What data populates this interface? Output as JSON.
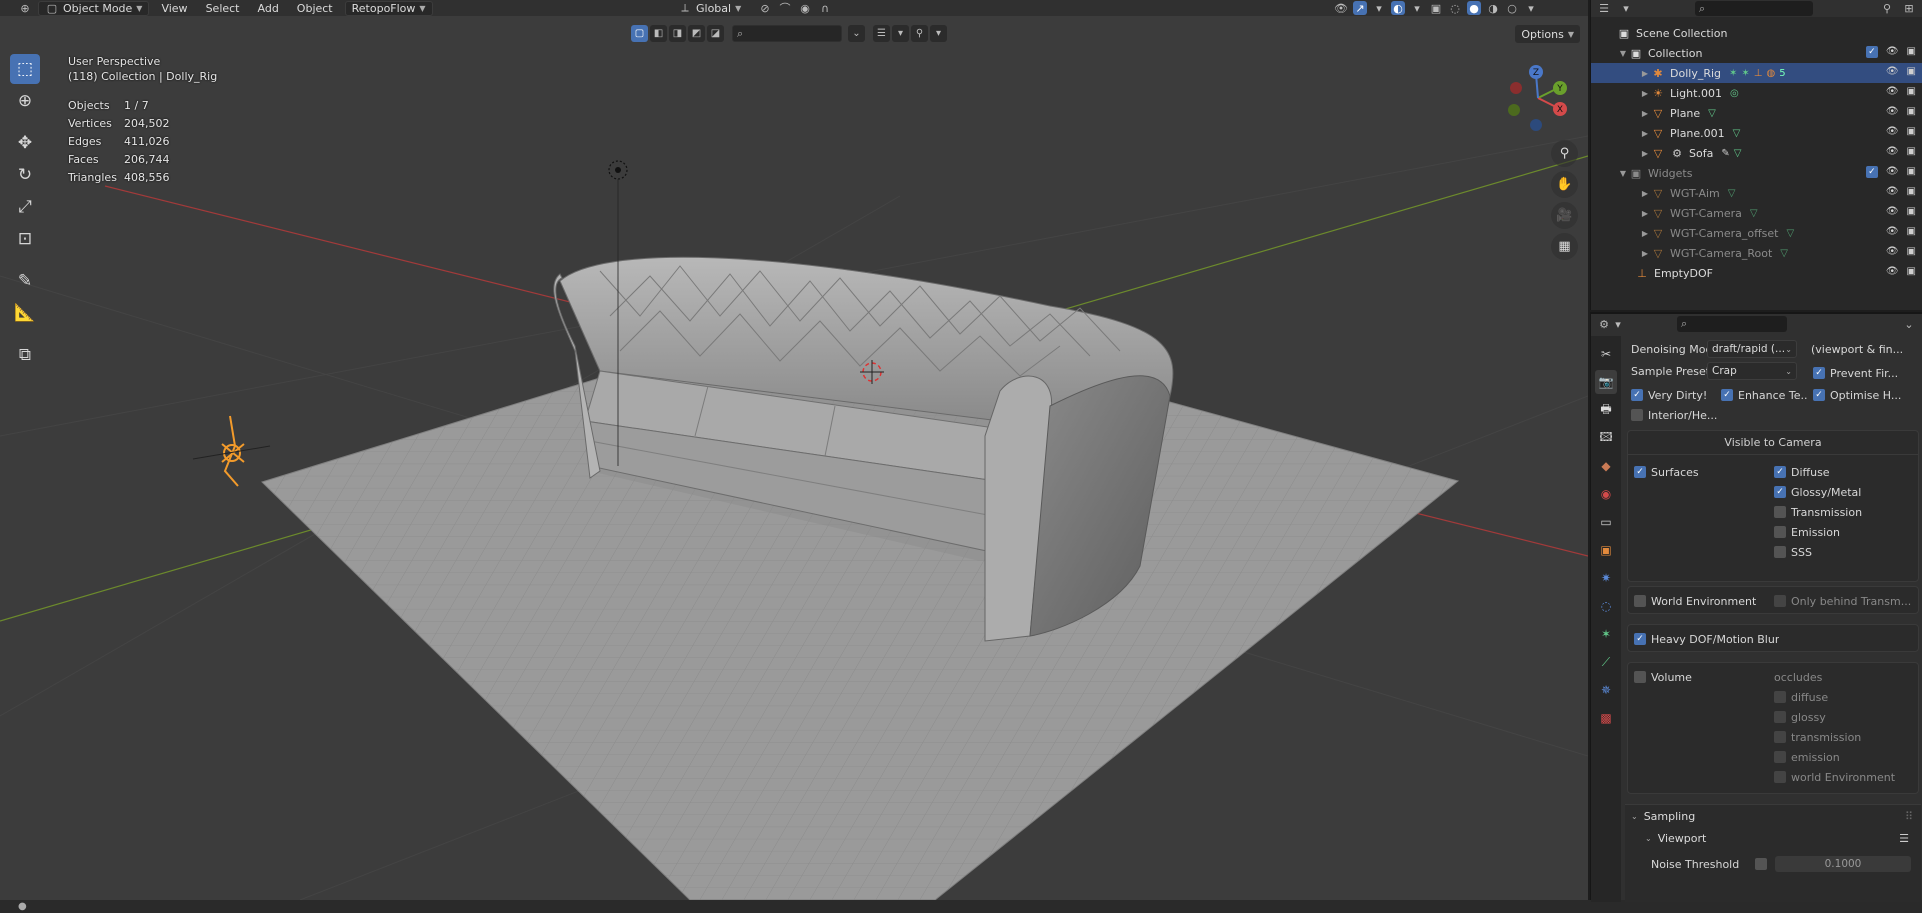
{
  "header": {
    "mode": "Object Mode",
    "menus": [
      "View",
      "Select",
      "Add",
      "Object",
      "RetopoFlow"
    ],
    "transform_orientation": "Global",
    "options_label": "Options"
  },
  "overlay": {
    "perspective": "User Perspective",
    "collection_line": "(118) Collection | Dolly_Rig",
    "stats": [
      {
        "label": "Objects",
        "value": "1 / 7"
      },
      {
        "label": "Vertices",
        "value": "204,502"
      },
      {
        "label": "Edges",
        "value": "411,026"
      },
      {
        "label": "Faces",
        "value": "206,744"
      },
      {
        "label": "Triangles",
        "value": "408,556"
      }
    ]
  },
  "gizmo": {
    "x": "X",
    "y": "Y",
    "z": "Z"
  },
  "outliner": {
    "scene_collection": "Scene Collection",
    "collection": "Collection",
    "items": [
      {
        "name": "Dolly_Rig",
        "selected": true,
        "badge": "5"
      },
      {
        "name": "Light.001"
      },
      {
        "name": "Plane"
      },
      {
        "name": "Plane.001"
      },
      {
        "name": "Sofa"
      }
    ],
    "widgets": "Widgets",
    "widget_items": [
      "WGT-Aim",
      "WGT-Camera",
      "WGT-Camera_offset",
      "WGT-Camera_Root"
    ],
    "empty": "EmptyDOF"
  },
  "properties": {
    "denoising_mode_label": "Denoising Mode",
    "denoising_mode_value": "draft/rapid (...",
    "denoising_side": "(viewport & fin...",
    "sample_presets_label": "Sample Presets",
    "sample_presets_value": "Crap",
    "prevent_fireflies": "Prevent Fir...",
    "very_dirty": "Very Dirty!",
    "enhance": "Enhance Te...",
    "optimise": "Optimise H...",
    "interior": "Interior/He...",
    "visible_to_camera": "Visible to Camera",
    "surfaces": "Surfaces",
    "diffuse": "Diffuse",
    "glossy": "Glossy/Metal",
    "transmission": "Transmission",
    "emission": "Emission",
    "sss": "SSS",
    "world_env": "World Environment",
    "only_behind": "Only behind Transm...",
    "heavy_dof": "Heavy DOF/Motion Blur",
    "volume": "Volume",
    "occludes": "occludes",
    "vol_diffuse": "diffuse",
    "vol_glossy": "glossy",
    "vol_transmission": "transmission",
    "vol_emission": "emission",
    "vol_world": "world Environment",
    "sampling": "Sampling",
    "viewport": "Viewport",
    "noise_threshold_label": "Noise Threshold",
    "noise_threshold_value": "0.1000"
  },
  "colors": {
    "accent": "#4772b3",
    "selection": "#334d80",
    "object_orange": "#e38a3c",
    "mesh_green": "#62c98a"
  }
}
